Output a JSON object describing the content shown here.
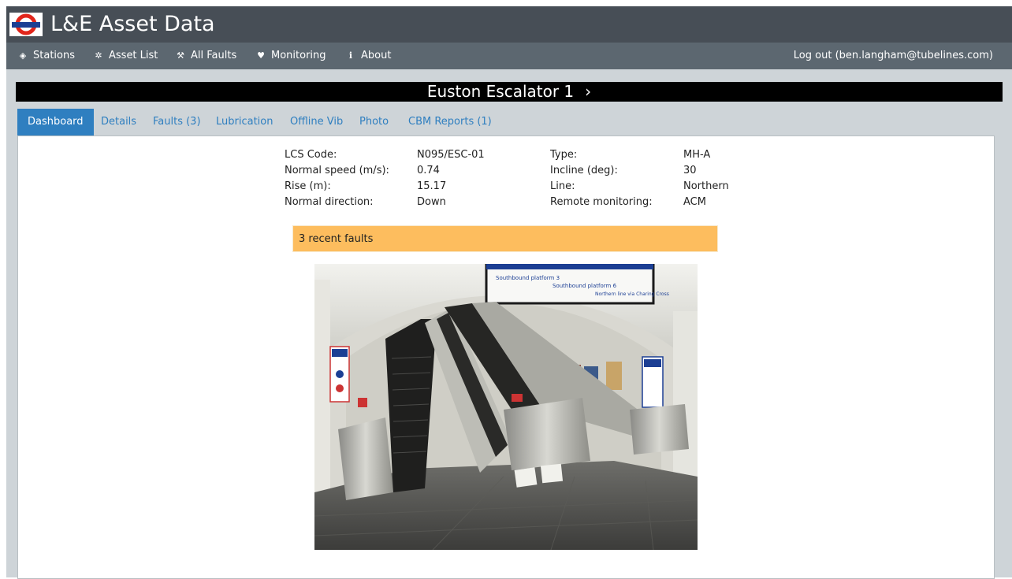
{
  "app": {
    "title": "L&E Asset Data",
    "logo_icon": "london-underground-roundel-icon"
  },
  "nav": {
    "items": [
      {
        "label": "Stations",
        "icon": "cube-icon"
      },
      {
        "label": "Asset List",
        "icon": "gear-icon"
      },
      {
        "label": "All Faults",
        "icon": "wrench-icon"
      },
      {
        "label": "Monitoring",
        "icon": "heartbeat-icon"
      },
      {
        "label": "About",
        "icon": "info-icon"
      }
    ],
    "logout": "Log out (ben.langham@tubelines.com)"
  },
  "asset": {
    "title": "Euston Escalator 1",
    "next": "›"
  },
  "tabs": [
    "Dashboard",
    "Details",
    "Faults (3)",
    "Lubrication",
    "Offline Vib",
    "Photo",
    "CBM Reports (1)"
  ],
  "active_tab": "Dashboard",
  "info": {
    "left": [
      {
        "label": "LCS Code:",
        "value": "N095/ESC-01"
      },
      {
        "label": "Normal speed (m/s):",
        "value": "0.74"
      },
      {
        "label": "Rise (m):",
        "value": "15.17"
      },
      {
        "label": "Normal direction:",
        "value": "Down"
      }
    ],
    "right": [
      {
        "label": "Type:",
        "value": "MH-A"
      },
      {
        "label": "Incline (deg):",
        "value": "30"
      },
      {
        "label": "Line:",
        "value": "Northern"
      },
      {
        "label": "Remote monitoring:",
        "value": "ACM"
      }
    ]
  },
  "alert": "3 recent faults",
  "photo": {
    "sign_texts": [
      "Southbound platform 3",
      "Southbound platform 6",
      "Northern line via Charing Cross"
    ]
  },
  "colors": {
    "titlebar": "#474e56",
    "navbar": "#5c6770",
    "accent": "#2f7fc0",
    "alert": "#fdbd5e",
    "page": "#ced4d8"
  }
}
